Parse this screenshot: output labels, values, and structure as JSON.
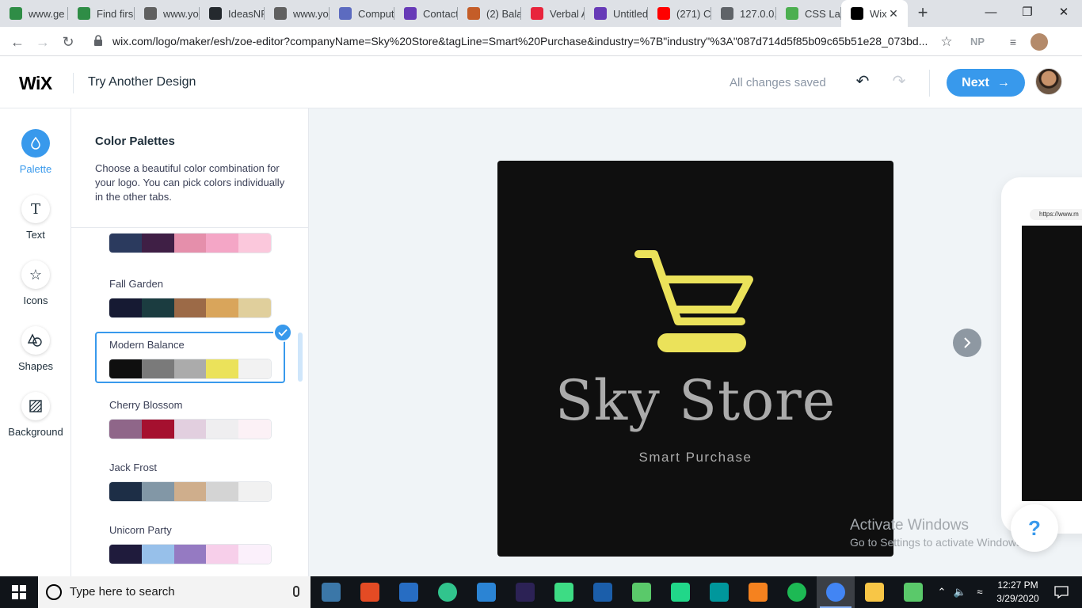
{
  "browser": {
    "tabs": [
      {
        "label": "www.ge",
        "favicon": "geeks-icon",
        "color": "#2f8d46"
      },
      {
        "label": "Find firs",
        "favicon": "geeks-icon",
        "color": "#2f8d46"
      },
      {
        "label": "www.yo",
        "favicon": "video-icon",
        "color": "#606060"
      },
      {
        "label": "IdeasNF",
        "favicon": "github-icon",
        "color": "#24292e"
      },
      {
        "label": "www.yo",
        "favicon": "video-icon",
        "color": "#606060"
      },
      {
        "label": "Comput",
        "favicon": "gear-icon",
        "color": "#5c6bc0"
      },
      {
        "label": "Contact",
        "favicon": "form-icon",
        "color": "#673ab7"
      },
      {
        "label": "(2) Bala",
        "favicon": "quora-icon",
        "color": "#c45d28"
      },
      {
        "label": "Verbal A",
        "favicon": "verbal-icon",
        "color": "#e8243c"
      },
      {
        "label": "Untitled",
        "favicon": "form-icon",
        "color": "#673ab7"
      },
      {
        "label": "(271) CS",
        "favicon": "youtube-icon",
        "color": "#ff0000"
      },
      {
        "label": "127.0.0.",
        "favicon": "globe-icon",
        "color": "#5f6368"
      },
      {
        "label": "CSS Lay",
        "favicon": "w3-icon",
        "color": "#4caf50"
      },
      {
        "label": "Wix",
        "favicon": "wix-icon",
        "color": "#000000"
      }
    ],
    "url": "wix.com/logo/maker/esh/zoe-editor?companyName=Sky%20Store&tagLine=Smart%20Purchase&industry=%7B\"industry\"%3A\"087d714d5f85b09c65b51e28_073bd...",
    "profile_initials": "NP"
  },
  "header": {
    "brand": "WiX",
    "try_another": "Try Another Design",
    "status": "All changes saved",
    "next_label": "Next",
    "accent": "#3899ec"
  },
  "rail": {
    "items": [
      {
        "label": "Palette",
        "icon": "droplet-icon"
      },
      {
        "label": "Text",
        "icon": "text-icon"
      },
      {
        "label": "Icons",
        "icon": "star-icon"
      },
      {
        "label": "Shapes",
        "icon": "shapes-icon"
      },
      {
        "label": "Background",
        "icon": "background-icon"
      }
    ]
  },
  "panel": {
    "title": "Color Palettes",
    "description": "Choose a beautiful color combination for your logo. You can pick colors individually in the other tabs.",
    "palettes": [
      {
        "name": "",
        "colors": [
          "#2b3a5e",
          "#3f1f45",
          "#e58fab",
          "#f4a6c6",
          "#fbc8dc"
        ]
      },
      {
        "name": "Fall Garden",
        "colors": [
          "#161a33",
          "#1b3c40",
          "#9c6a47",
          "#d9a55b",
          "#e0cf9c"
        ]
      },
      {
        "name": "Modern Balance",
        "colors": [
          "#0f0f0f",
          "#7a7a7a",
          "#ababab",
          "#ebe25a",
          "#f2f2f2"
        ],
        "selected": true
      },
      {
        "name": "Cherry Blossom",
        "colors": [
          "#8f6689",
          "#a5102f",
          "#e2cfdf",
          "#efeef0",
          "#fcf1f6"
        ]
      },
      {
        "name": "Jack Frost",
        "colors": [
          "#1d2e46",
          "#8297a6",
          "#cfae8c",
          "#d4d4d4",
          "#f1f1f1"
        ]
      },
      {
        "name": "Unicorn Party",
        "colors": [
          "#1f1b3c",
          "#97c0ea",
          "#957ac2",
          "#f7cfea",
          "#fbf0fb"
        ]
      }
    ]
  },
  "logo": {
    "company": "Sky Store",
    "tagline": "Smart Purchase",
    "icon": "shopping-cart-icon",
    "background": "#0f0f0f",
    "icon_color": "#ebe25a",
    "text_color": "#ababab"
  },
  "mockup": {
    "url_text": "https://www.m"
  },
  "watermark": {
    "line1": "Activate Windows",
    "line2": "Go to Settings to activate Windows."
  },
  "help_label": "?",
  "taskbar": {
    "search_placeholder": "Type here to search",
    "time": "12:27 PM",
    "date": "3/29/2020",
    "apps": [
      {
        "name": "python-idle-icon",
        "color": "#3b77a8"
      },
      {
        "name": "office-icon",
        "color": "#e44b24"
      },
      {
        "name": "r-icon",
        "color": "#276dc3"
      },
      {
        "name": "ring-app-icon",
        "color": "#31c48d"
      },
      {
        "name": "monitor-icon",
        "color": "#2b84d4"
      },
      {
        "name": "eclipse-icon",
        "color": "#2c2255"
      },
      {
        "name": "android-studio-icon",
        "color": "#3ddc84"
      },
      {
        "name": "virtualbox-icon",
        "color": "#1b5eaa"
      },
      {
        "name": "atom-icon",
        "color": "#5ac96a"
      },
      {
        "name": "pycharm-icon",
        "color": "#21d789"
      },
      {
        "name": "arduino-icon",
        "color": "#00979c"
      },
      {
        "name": "media-player-icon",
        "color": "#f5821f"
      },
      {
        "name": "spotify-icon",
        "color": "#1db954"
      },
      {
        "name": "chrome-icon",
        "color": "#4285f4"
      },
      {
        "name": "file-explorer-icon",
        "color": "#f8c646"
      },
      {
        "name": "atom-icon",
        "color": "#5ac96a"
      }
    ]
  }
}
